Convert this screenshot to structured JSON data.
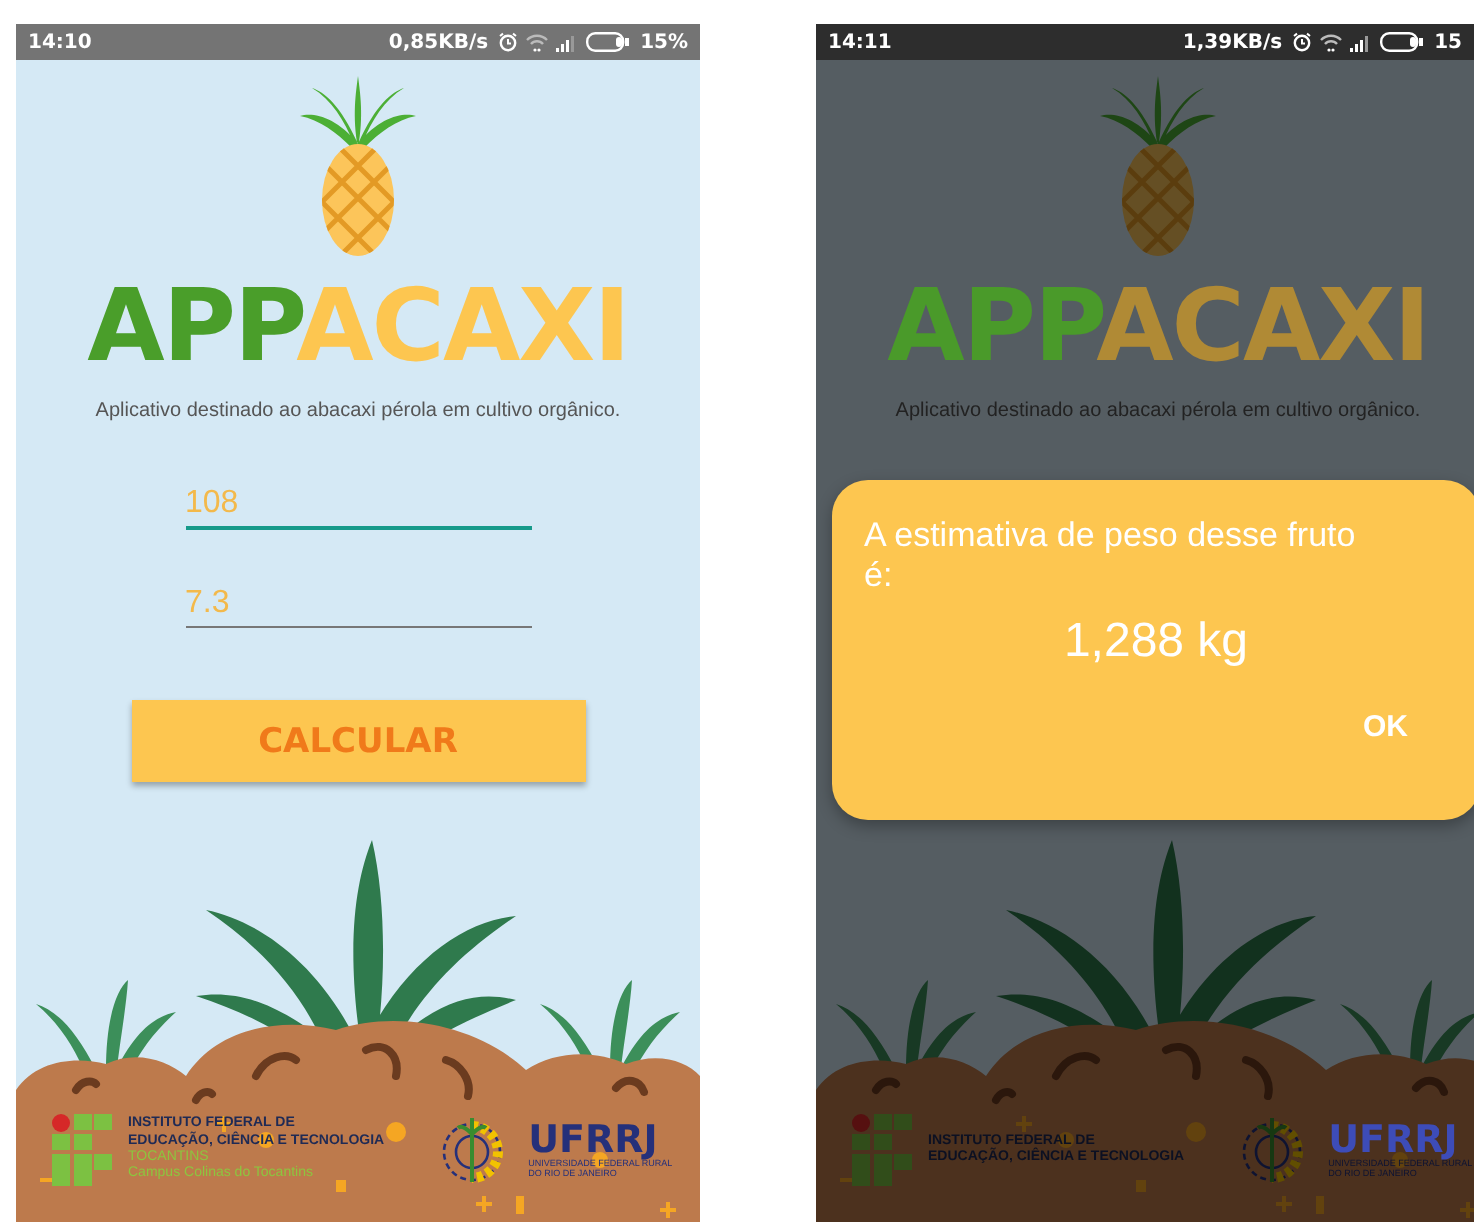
{
  "screens": [
    {
      "status_bar": {
        "time": "14:10",
        "speed": "0,85KB/s",
        "battery": "15%"
      },
      "dimmed": false,
      "app": {
        "title_green": "APP",
        "title_yellow": "ACAXI",
        "tagline": "Aplicativo destinado ao abacaxi pérola em cultivo orgânico.",
        "fields": [
          {
            "value": "108",
            "focused": true
          },
          {
            "value": "7.3",
            "focused": false
          }
        ],
        "button": "CALCULAR"
      },
      "footer": {
        "institute": [
          "INSTITUTO FEDERAL DE",
          "EDUCAÇÃO, CIÊNCIA E TECNOLOGIA"
        ],
        "state": "TOCANTINS",
        "campus": "Campus Colinas do Tocantins",
        "university": "UFRRJ",
        "university_name": [
          "UNIVERSIDADE FEDERAL RURAL",
          "DO RIO DE JANEIRO"
        ]
      }
    },
    {
      "status_bar": {
        "time": "14:11",
        "speed": "1,39KB/s",
        "battery": "15"
      },
      "dimmed": true,
      "app": {
        "title_green": "APP",
        "title_yellow": "ACAXI",
        "tagline": "Aplicativo destinado ao abacaxi pérola em cultivo orgânico."
      },
      "footer": {
        "institute": [
          "INSTITUTO FEDERAL DE",
          "EDUCAÇÃO, CIÊNCIA E TECNOLOGIA"
        ],
        "university": "UFRRJ",
        "university_name": [
          "UNIVERSIDADE FEDERAL RURAL",
          "DO RIO DE JANEIRO"
        ]
      },
      "dialog": {
        "message": "A estimativa de peso desse fruto é:",
        "result": "1,288 kg",
        "ok": "OK"
      }
    }
  ]
}
